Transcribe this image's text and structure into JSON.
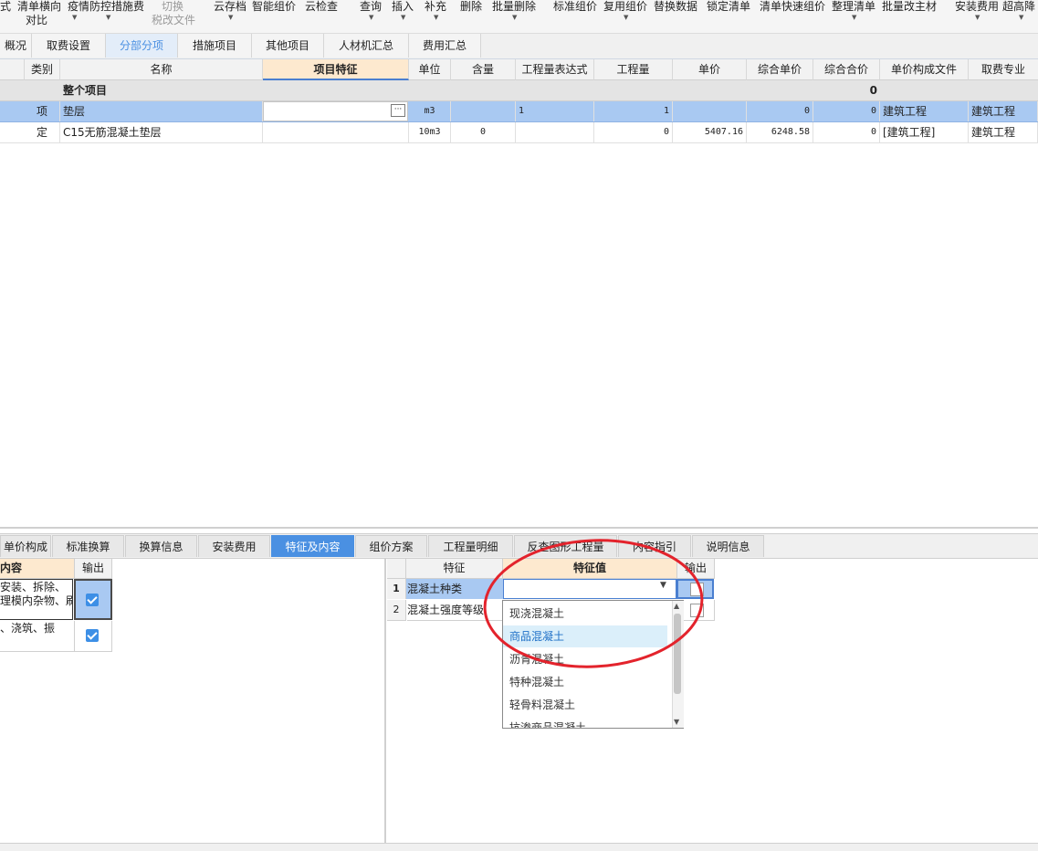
{
  "toolbar": {
    "items": [
      {
        "l1": "式",
        "l2": ""
      },
      {
        "l1": "清单横向",
        "l2": "对比"
      },
      {
        "l1": "疫情防控措施费",
        "l2": ""
      },
      {
        "l1": "切换",
        "l2": "税改文件"
      },
      {
        "l1": "云存档",
        "l2": ""
      },
      {
        "l1": "智能组价",
        "l2": ""
      },
      {
        "l1": "云检查",
        "l2": ""
      },
      {
        "l1": "查询",
        "l2": ""
      },
      {
        "l1": "插入",
        "l2": ""
      },
      {
        "l1": "补充",
        "l2": ""
      },
      {
        "l1": "删除",
        "l2": ""
      },
      {
        "l1": "批量删除",
        "l2": ""
      },
      {
        "l1": "标准组价",
        "l2": ""
      },
      {
        "l1": "复用组价",
        "l2": ""
      },
      {
        "l1": "替换数据",
        "l2": ""
      },
      {
        "l1": "锁定清单",
        "l2": ""
      },
      {
        "l1": "清单快速组价",
        "l2": ""
      },
      {
        "l1": "整理清单",
        "l2": ""
      },
      {
        "l1": "批量改主材",
        "l2": ""
      },
      {
        "l1": "安装费用",
        "l2": ""
      },
      {
        "l1": "超高降",
        "l2": ""
      }
    ]
  },
  "tabs": [
    "概况",
    "取费设置",
    "分部分项",
    "措施项目",
    "其他项目",
    "人材机汇总",
    "费用汇总"
  ],
  "grid": {
    "headers": [
      "类别",
      "名称",
      "项目特征",
      "单位",
      "含量",
      "工程量表达式",
      "工程量",
      "单价",
      "综合单价",
      "综合合价",
      "单价构成文件",
      "取费专业"
    ],
    "group_row": {
      "name": "整个项目",
      "total": "0"
    },
    "rows": [
      {
        "type": "项",
        "name": "垫层",
        "feature": "",
        "unit": "m3",
        "content": "",
        "expr": "1",
        "qty": "1",
        "price": "",
        "unit_total": "0",
        "sum_total": "0",
        "file": "建筑工程",
        "major": "建筑工程"
      },
      {
        "type": "定",
        "name": "C15无筋混凝土垫层",
        "feature": "",
        "unit": "10m3",
        "content": "0",
        "expr": "",
        "qty": "0",
        "price": "5407.16",
        "unit_total": "6248.58",
        "sum_total": "0",
        "file": "[建筑工程]",
        "major": "建筑工程"
      }
    ],
    "ellipsis": "···"
  },
  "bottom_tabs": [
    "单价构成",
    "标准换算",
    "换算信息",
    "安装费用",
    "特征及内容",
    "组价方案",
    "工程量明细",
    "反查图形工程量",
    "内容指引",
    "说明信息"
  ],
  "left_panel": {
    "headers": [
      "内容",
      "输出"
    ],
    "rows": [
      {
        "line1": "安装、拆除、",
        "line2": "理模内杂物、刷"
      },
      {
        "line1": "、浇筑、振",
        "line2": ""
      }
    ]
  },
  "feature_panel": {
    "headers": [
      "特征",
      "特征值",
      "输出"
    ],
    "rows": [
      {
        "num": "1",
        "name": "混凝土种类"
      },
      {
        "num": "2",
        "name": "混凝土强度等级"
      }
    ]
  },
  "dropdown": {
    "options": [
      "现浇混凝土",
      "商品混凝土",
      "沥青混凝土",
      "特种混凝土",
      "轻骨料混凝土",
      "抗渗商品混凝土"
    ],
    "selected_index": 1
  },
  "annotation_color": "#e3232c",
  "accent_color": "#4a90e2"
}
